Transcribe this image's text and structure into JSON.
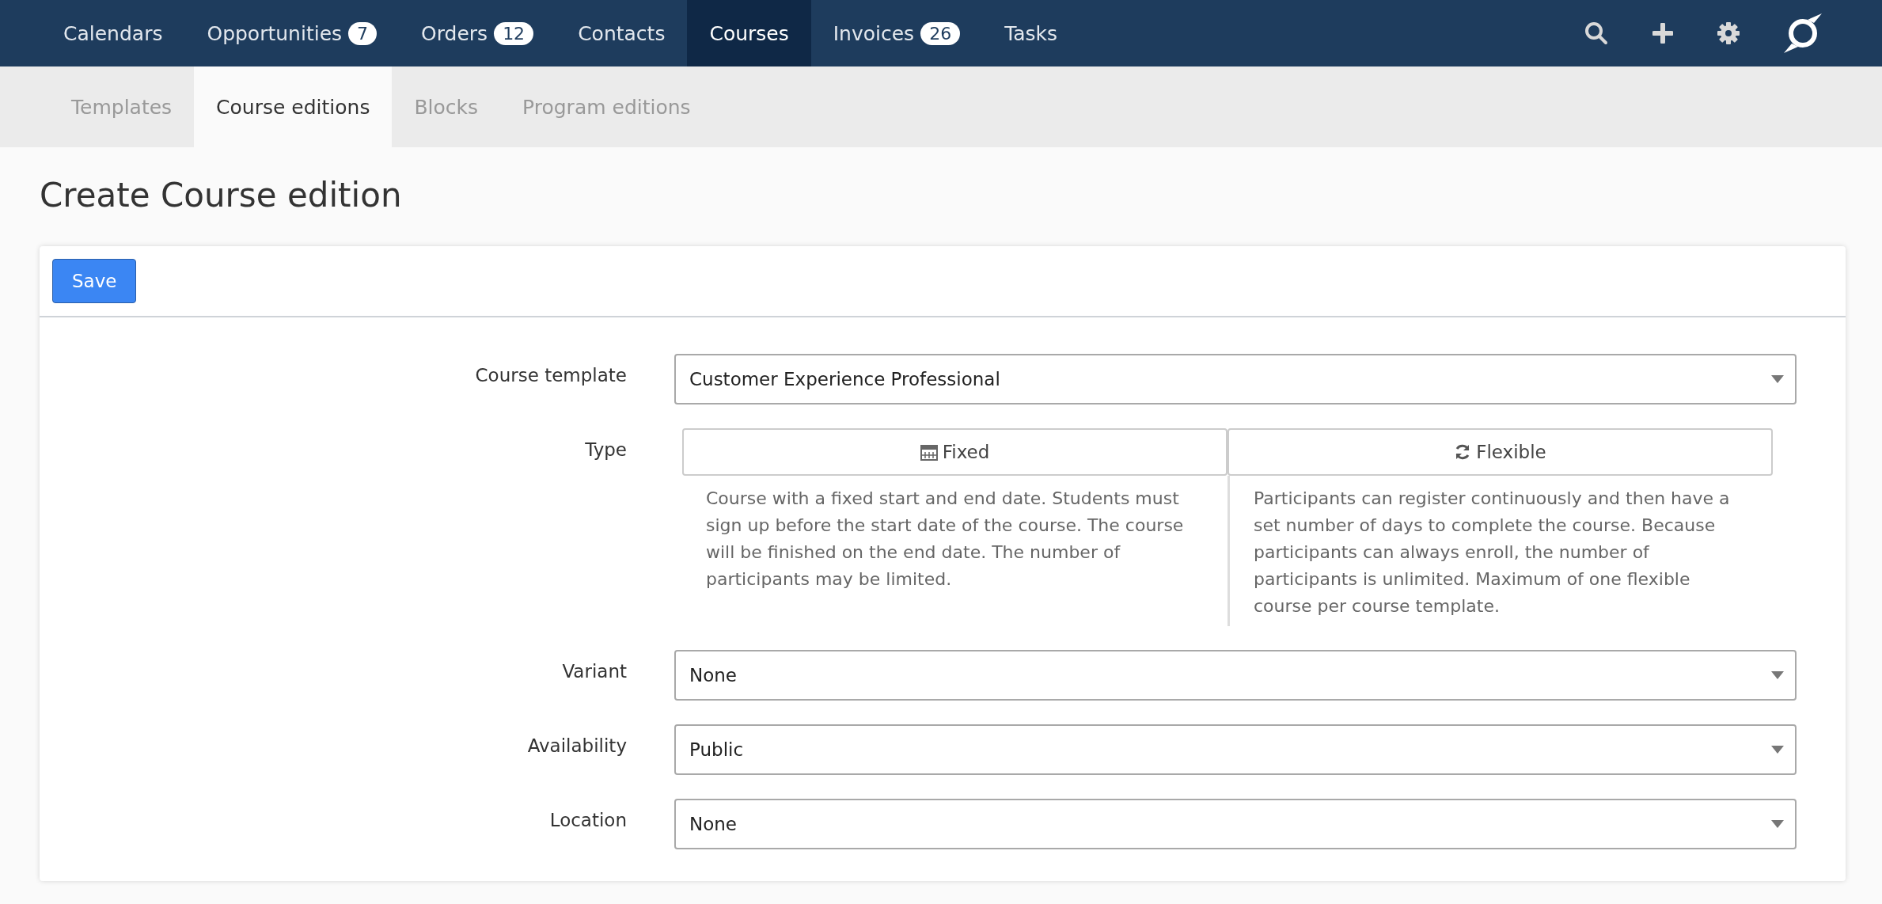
{
  "nav": {
    "items": [
      {
        "label": "Calendars",
        "selected": false
      },
      {
        "label": "Opportunities",
        "badge": "7",
        "selected": false
      },
      {
        "label": "Orders",
        "badge": "12",
        "selected": false
      },
      {
        "label": "Contacts",
        "selected": false
      },
      {
        "label": "Courses",
        "selected": true
      },
      {
        "label": "Invoices",
        "badge": "26",
        "selected": false
      },
      {
        "label": "Tasks",
        "selected": false
      }
    ]
  },
  "subnav": {
    "tabs": [
      {
        "label": "Templates",
        "selected": false
      },
      {
        "label": "Course editions",
        "selected": true
      },
      {
        "label": "Blocks",
        "selected": false
      },
      {
        "label": "Program editions",
        "selected": false
      }
    ]
  },
  "page_title": "Create Course edition",
  "toolbar": {
    "save_button": "Save"
  },
  "form": {
    "course_template": {
      "label": "Course template",
      "value": "Customer Experience Professional"
    },
    "type": {
      "label": "Type",
      "options": [
        {
          "label": "Fixed",
          "kind": "calendar",
          "selected": false,
          "description": "Course with a fixed start and end date. Students must sign up before the start date of the course. The course will be finished on the end date. The number of participants may be limited."
        },
        {
          "label": "Flexible",
          "kind": "refresh",
          "selected": false,
          "description": "Participants can register continuously and then have a set number of days to complete the course. Because participants can always enroll, the number of participants is unlimited. Maximum of one flexible course per course template."
        }
      ]
    },
    "selects": [
      {
        "label": "Variant",
        "value": "None"
      },
      {
        "label": "Availability",
        "value": "Public"
      },
      {
        "label": "Location",
        "value": "None"
      }
    ]
  }
}
